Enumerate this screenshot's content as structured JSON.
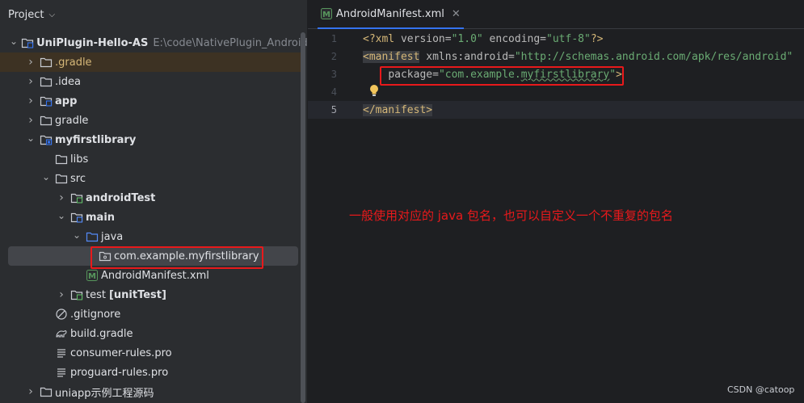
{
  "project_panel": {
    "title": "Project",
    "tree": [
      {
        "label": "UniPlugin-Hello-AS",
        "path": "E:\\code\\NativePlugin_Android-SDK",
        "icon": "module-folder-icon",
        "depth": 0,
        "arrow": "down",
        "bold": true
      },
      {
        "label": ".gradle",
        "icon": "folder-icon",
        "depth": 1,
        "arrow": "right"
      },
      {
        "label": ".idea",
        "icon": "folder-icon",
        "depth": 1,
        "arrow": "right"
      },
      {
        "label": "app",
        "icon": "module-folder-icon",
        "depth": 1,
        "arrow": "right",
        "bold": true
      },
      {
        "label": "gradle",
        "icon": "folder-icon",
        "depth": 1,
        "arrow": "right"
      },
      {
        "label": "myfirstlibrary",
        "icon": "library-module-icon",
        "depth": 1,
        "arrow": "down",
        "bold": true
      },
      {
        "label": "libs",
        "icon": "folder-icon",
        "depth": 2,
        "arrow": ""
      },
      {
        "label": "src",
        "icon": "folder-icon",
        "depth": 2,
        "arrow": "down"
      },
      {
        "label": "androidTest",
        "icon": "test-source-folder-icon",
        "depth": 3,
        "arrow": "right",
        "bold": true
      },
      {
        "label": "main",
        "icon": "source-root-folder-icon",
        "depth": 3,
        "arrow": "down",
        "bold": true
      },
      {
        "label": "java",
        "icon": "source-folder-icon",
        "depth": 4,
        "arrow": "down"
      },
      {
        "label": "com.example.myfirstlibrary",
        "icon": "package-icon",
        "depth": 5,
        "arrow": ""
      },
      {
        "label": "AndroidManifest.xml",
        "icon": "manifest-file-icon",
        "depth": 4,
        "arrow": ""
      },
      {
        "label": "test",
        "suffix": "[unitTest]",
        "icon": "test-folder-icon",
        "depth": 3,
        "arrow": "right"
      },
      {
        "label": ".gitignore",
        "icon": "gitignore-icon",
        "depth": 2,
        "arrow": ""
      },
      {
        "label": "build.gradle",
        "icon": "gradle-file-icon",
        "depth": 2,
        "arrow": ""
      },
      {
        "label": "consumer-rules.pro",
        "icon": "text-file-icon",
        "depth": 2,
        "arrow": ""
      },
      {
        "label": "proguard-rules.pro",
        "icon": "text-file-icon",
        "depth": 2,
        "arrow": ""
      },
      {
        "label": "uniapp示例工程源码",
        "icon": "folder-icon",
        "depth": 1,
        "arrow": "right"
      }
    ]
  },
  "editor": {
    "tab_label": "AndroidManifest.xml",
    "line_numbers": [
      "1",
      "2",
      "3",
      "4",
      "5"
    ],
    "line1": {
      "open": "<?",
      "name": "xml",
      "attr1": " version=",
      "val1": "\"1.0\"",
      "attr2": " encoding=",
      "val2": "\"utf-8\"",
      "close": "?>"
    },
    "line2": {
      "open": "<",
      "name": "manifest",
      "attr": " xmlns:android=",
      "val": "\"http://schemas.android.com/apk/res/android\""
    },
    "line3": {
      "indent": "    ",
      "attr": "package=",
      "val_pre": "\"com.example.",
      "val_sq": "myfirstlibrary",
      "val_post": "\"",
      "close": ">"
    },
    "line5": {
      "open": "</",
      "name": "manifest",
      "close": ">"
    }
  },
  "annotation": "一般使用对应的 java 包名，也可以自定义一个不重复的包名",
  "watermark": "CSDN @catoop",
  "colors": {
    "annotation_red": "#e8191b",
    "accent_blue": "#3574f0"
  }
}
